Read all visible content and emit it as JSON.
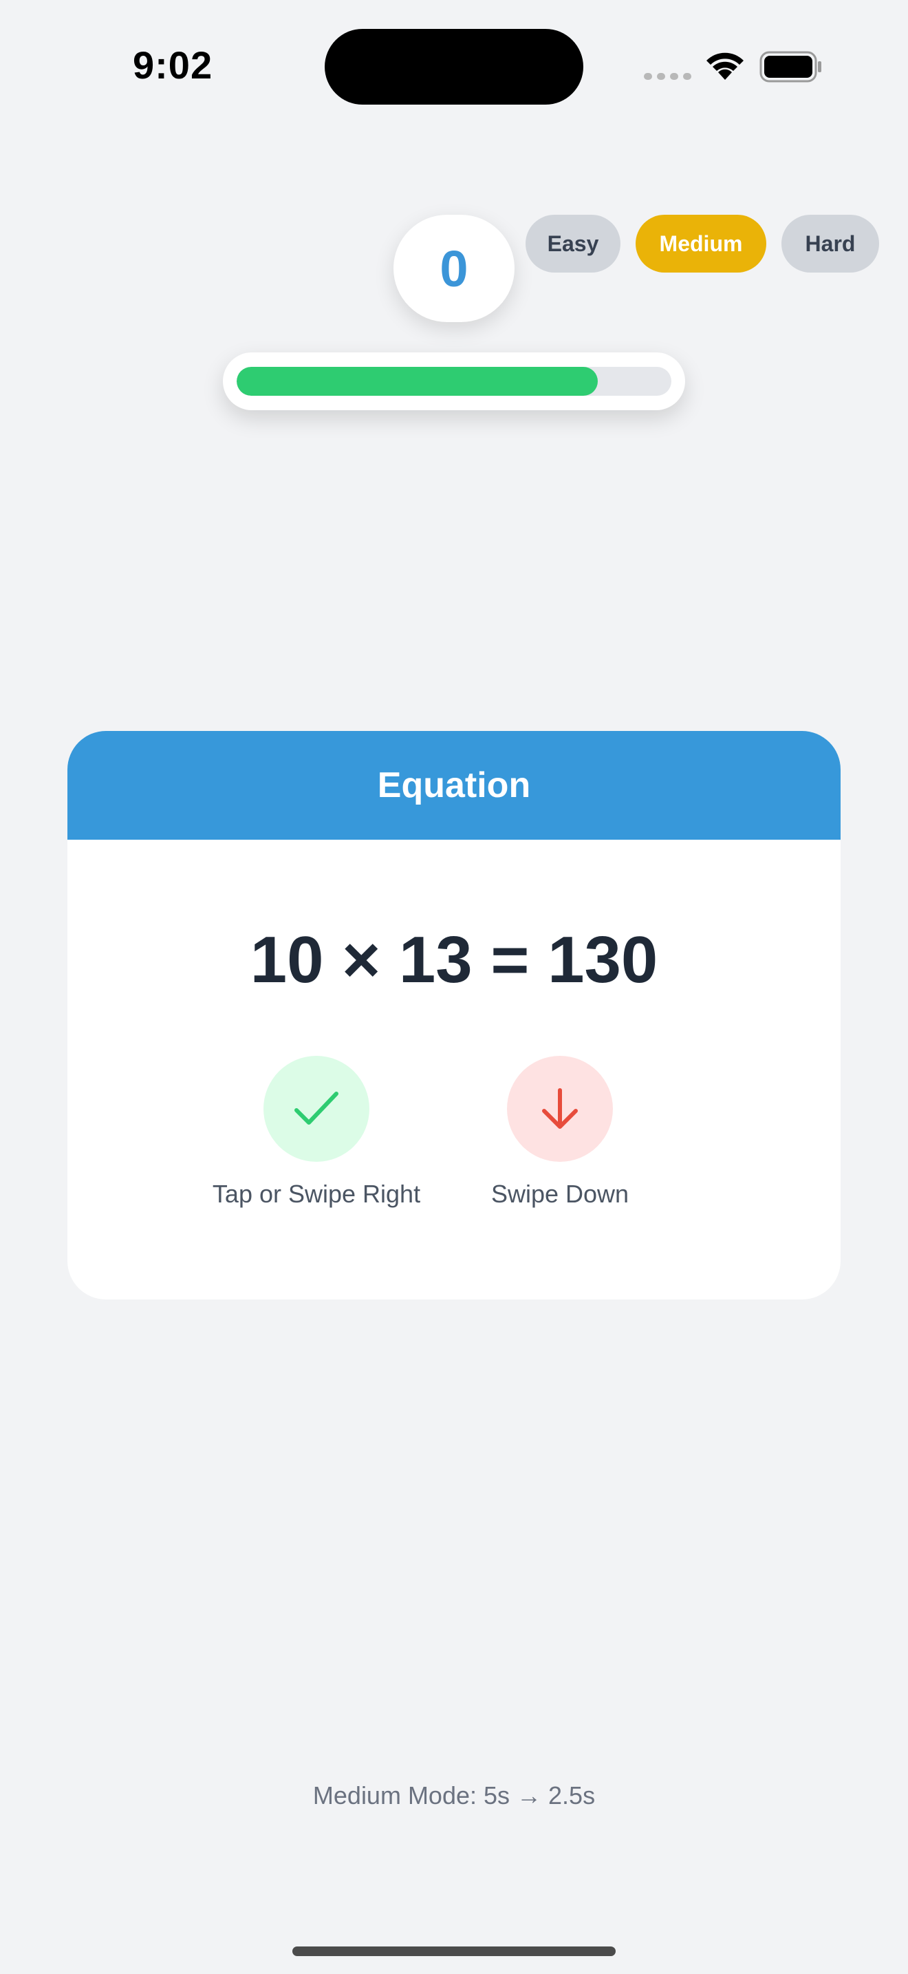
{
  "status_bar": {
    "time": "9:02"
  },
  "score": {
    "value": "0"
  },
  "difficulty": {
    "options": [
      "Easy",
      "Medium",
      "Hard"
    ],
    "selected": "Medium",
    "selected_color": "#eab308"
  },
  "timer": {
    "remaining_fraction": 0.83,
    "fill_color": "#2ecc71"
  },
  "card": {
    "header": "Equation",
    "header_color": "#3798da",
    "equation": "10 × 13 = 130",
    "correct_action": {
      "icon": "checkmark-icon",
      "label": "Tap or Swipe Right"
    },
    "wrong_action": {
      "icon": "arrow-down-icon",
      "label": "Swipe Down"
    }
  },
  "footer": {
    "mode_text": "Medium Mode: 5s → 2.5s"
  }
}
